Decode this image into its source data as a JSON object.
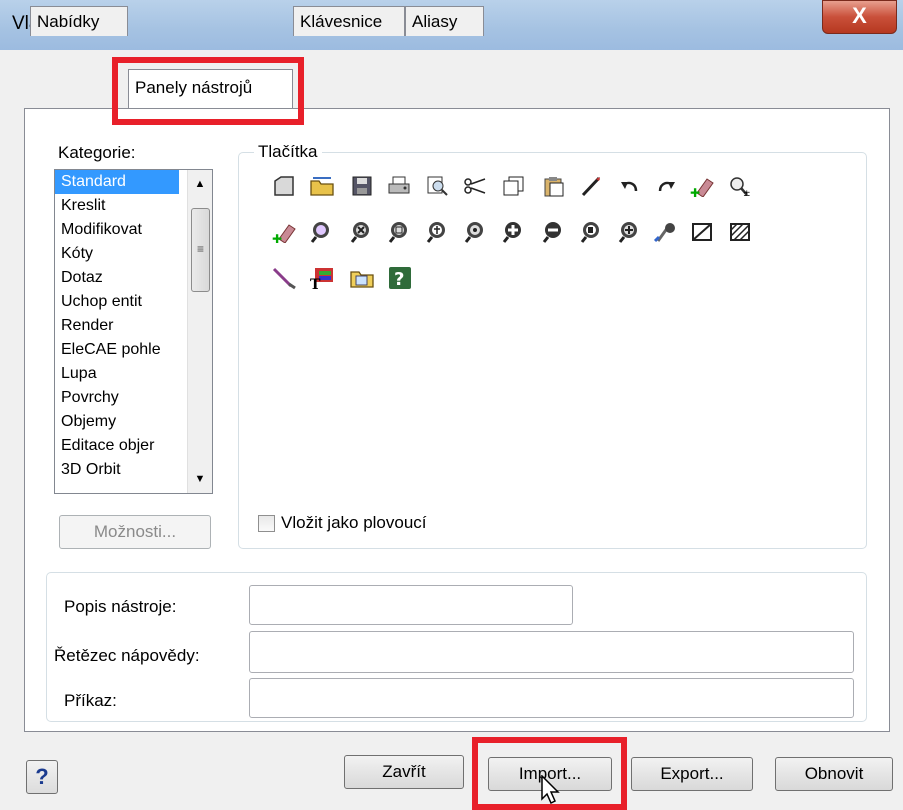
{
  "window": {
    "title": "Vlastní",
    "close_label": "X"
  },
  "tabs": [
    {
      "label": "Nabídky"
    },
    {
      "label": "Panely nástrojů"
    },
    {
      "label": "Klávesnice"
    },
    {
      "label": "Aliasy"
    }
  ],
  "categories": {
    "label": "Kategorie:",
    "items": [
      "Standard",
      "Kreslit",
      "Modifikovat",
      "Kóty",
      "Dotaz",
      "Uchop entit",
      "Render",
      "EleCAE pohle",
      "Lupa",
      "Povrchy",
      "Objemy",
      "Editace objer",
      "3D Orbit"
    ],
    "selected": "Standard"
  },
  "options_button": "Možnosti...",
  "buttons_group": {
    "label": "Tlačítka",
    "icons": [
      "new-icon",
      "open-folder-icon",
      "save-icon",
      "print-icon",
      "preview-icon",
      "cut-icon",
      "copy-icon",
      "paste-icon",
      "match-properties-icon",
      "undo-icon",
      "redo-icon",
      "erase-icon",
      "zoom-tag-icon",
      "pan-icon",
      "zoom-realtime-icon",
      "zoom-window-icon",
      "zoom-dynamic-icon",
      "zoom-scale-icon",
      "zoom-center-icon",
      "zoom-in-icon",
      "zoom-out-icon",
      "zoom-all-icon",
      "zoom-extents-icon",
      "redraw-icon",
      "shade-icon",
      "hatch-icon",
      "brush-icon",
      "text-style-icon",
      "folder-open-icon",
      "help-icon"
    ],
    "floating_checkbox_label": "Vložit jako plovoucí",
    "floating_checked": false
  },
  "details": {
    "description_label": "Popis nástroje:",
    "help_string_label": "Řetězec nápovědy:",
    "command_label": "Příkaz:",
    "description_value": "",
    "help_string_value": "",
    "command_value": ""
  },
  "footer": {
    "help_label": "?",
    "close_label": "Zavřít",
    "import_label": "Import...",
    "export_label": "Export...",
    "reset_label": "Obnovit"
  },
  "colors": {
    "highlight": "#e8202a",
    "selection": "#3399ff"
  }
}
